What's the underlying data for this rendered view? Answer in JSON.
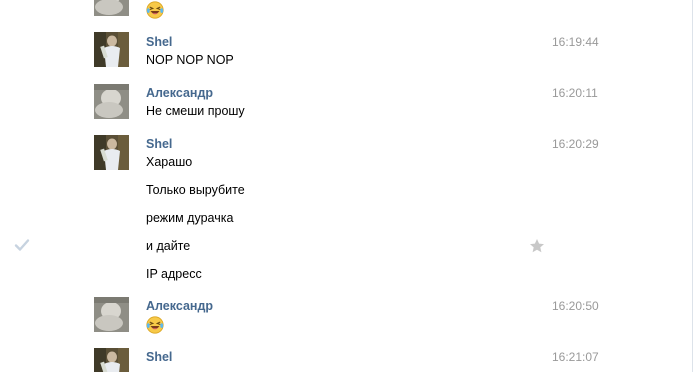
{
  "messages": [
    {
      "author": "",
      "time": "",
      "lines": [],
      "emoji": "laughing-tears"
    },
    {
      "author": "Shel",
      "time": "16:19:44",
      "lines": [
        "NOP NOP NOP"
      ]
    },
    {
      "author": "Александр",
      "time": "16:20:11",
      "lines": [
        "Не смеши прошу"
      ]
    },
    {
      "author": "Shel",
      "time": "16:20:29",
      "lines": [
        "Харашо",
        "Только вырубите",
        "режим дурачка",
        "и дайте",
        "IP адресс"
      ]
    },
    {
      "author": "Александр",
      "time": "16:20:50",
      "lines": [],
      "emoji": "laughing-tears"
    },
    {
      "author": "Shel",
      "time": "16:21:07",
      "lines": []
    }
  ],
  "icons": {
    "check": "check-icon",
    "star": "star-icon",
    "emoji": "laughing-tears-emoji"
  },
  "colors": {
    "author": "#45688e",
    "time": "#999999",
    "icon": "#c7d3e0",
    "star": "#c8c8c8"
  }
}
